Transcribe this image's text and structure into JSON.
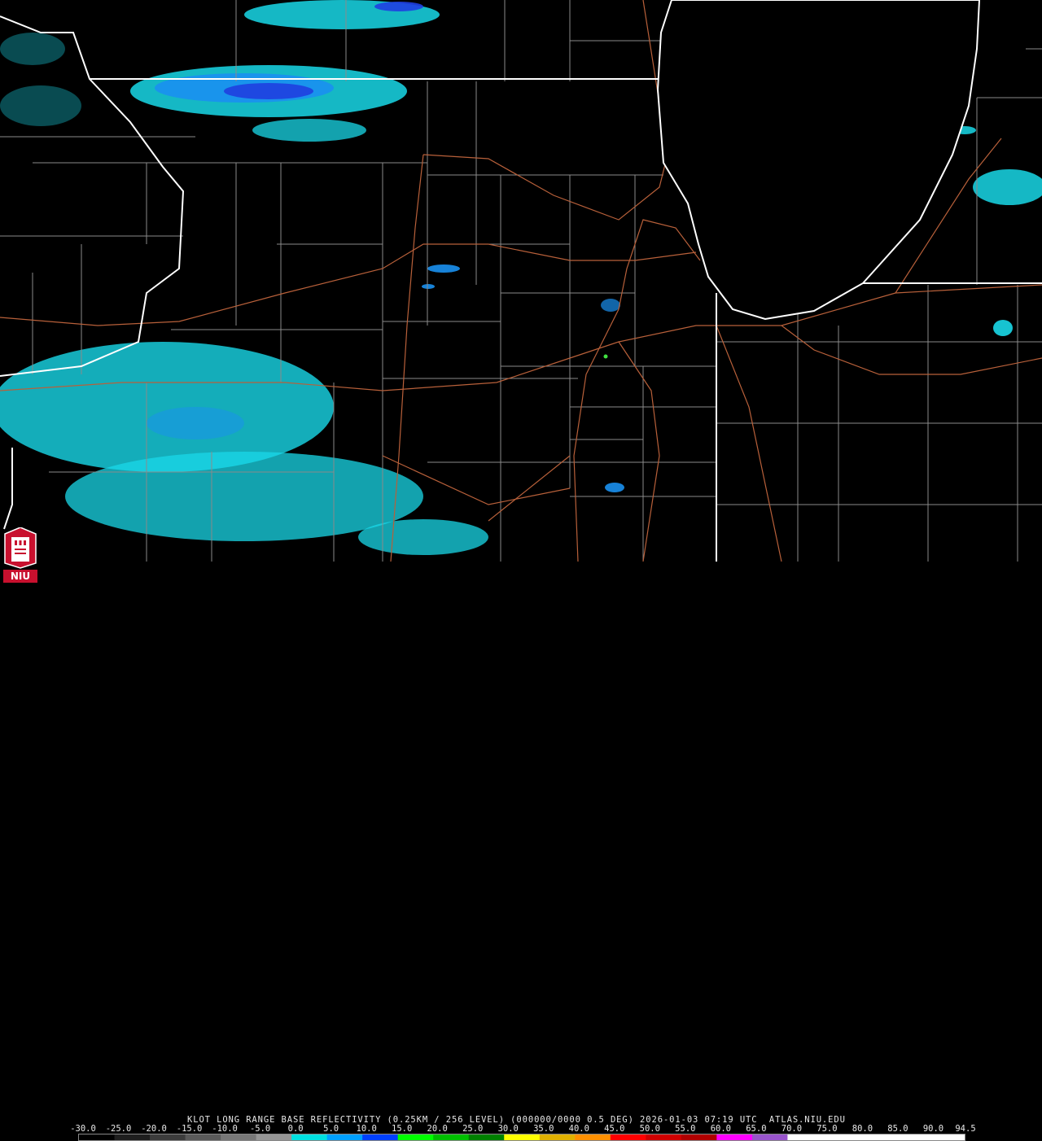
{
  "product": {
    "caption": "KLOT LONG RANGE BASE REFLECTIVITY (0.25KM / 256 LEVEL) (000000/0000 0.5 DEG) 2026-01-03 07:19 UTC  ATLAS.NIU.EDU",
    "logo_text": "NIU"
  },
  "colorbar": {
    "labels": [
      "-30.0",
      "-25.0",
      "-20.0",
      "-15.0",
      "-10.0",
      "-5.0",
      "0.0",
      "5.0",
      "10.0",
      "15.0",
      "20.0",
      "25.0",
      "30.0",
      "35.0",
      "40.0",
      "45.0",
      "50.0",
      "55.0",
      "60.0",
      "65.0",
      "70.0",
      "75.0",
      "80.0",
      "85.0",
      "90.0",
      "94.5"
    ],
    "colors": [
      "#000000",
      "#1e1e1e",
      "#3c3c3c",
      "#5a5a5a",
      "#787878",
      "#969696",
      "#00e0e0",
      "#00a0ff",
      "#0040ff",
      "#00ff00",
      "#00c000",
      "#008000",
      "#ffff00",
      "#e0b000",
      "#ff9000",
      "#ff0000",
      "#d00000",
      "#b00000",
      "#ff00ff",
      "#9955cc",
      "#ffffff",
      "#ffffff",
      "#ffffff",
      "#ffffff",
      "#ffffff"
    ]
  },
  "map": {
    "colors": {
      "state_border": "#ffffff",
      "county_border": "#8a8a8a",
      "highway": "#b8603a",
      "echo_light": "#19d8e8",
      "echo_medium": "#1a90ef",
      "echo_strong": "#1f3fe0",
      "echo_green": "#40e040",
      "lake": "#000000"
    }
  }
}
